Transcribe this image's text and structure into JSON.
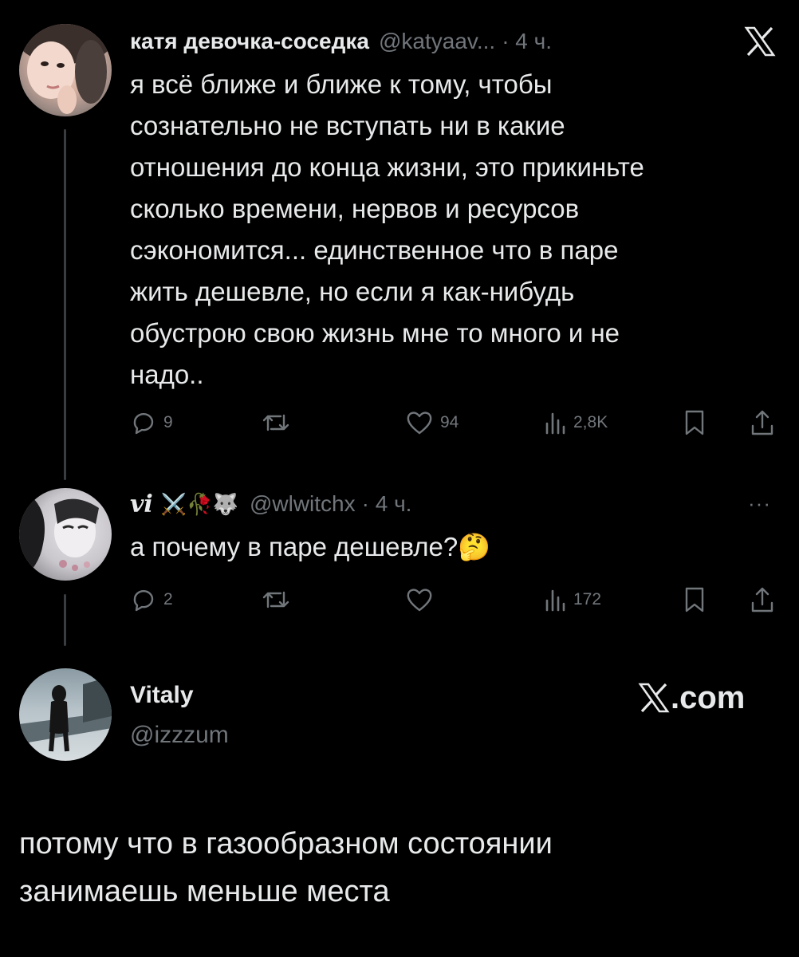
{
  "tweets": [
    {
      "name": "катя девочка-соседка",
      "handle": "@katyaav...",
      "time": "· 4 ч.",
      "lines": [
        "я всё ближе и ближе к тому, чтобы",
        "сознательно не вступать ни в какие",
        "отношения до конца жизни, это прикиньте",
        "сколько времени, нервов и ресурсов",
        "сэкономится... единственное что в паре",
        "жить дешевле, но если я как-нибудь",
        "обустрою свою жизнь мне то много и не",
        "надо.."
      ],
      "replies": "9",
      "likes": "94",
      "views": "2,8K"
    },
    {
      "name": "vi",
      "name_emojis": "⚔️🥀🐺",
      "handle": "@wlwitchx",
      "time": "· 4 ч.",
      "more": "···",
      "text": "а почему в паре дешевле?",
      "text_emoji": "🤔",
      "replies": "2",
      "views": "172"
    }
  ],
  "reply": {
    "name": "Vitaly",
    "handle": "@izzzum",
    "site": ".com",
    "lines": [
      "потому что в газообразном состоянии",
      "занимаешь меньше места"
    ]
  },
  "colors": {
    "background": "#000000",
    "text": "#e7e9ea",
    "muted": "#71767b",
    "thread_line": "#3a3d40"
  },
  "icons": [
    "x-logo-icon",
    "reply-icon",
    "retweet-icon",
    "like-icon",
    "views-icon",
    "bookmark-icon",
    "share-icon",
    "more-icon"
  ]
}
